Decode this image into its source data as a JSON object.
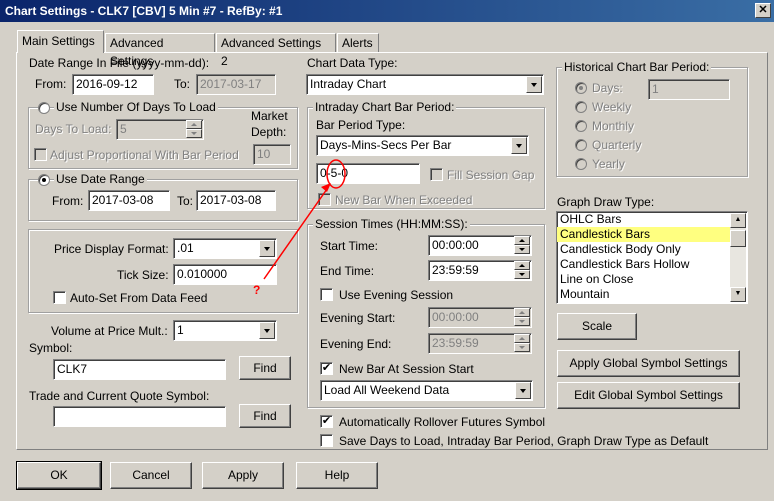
{
  "window": {
    "title": "Chart Settings - CLK7 [CBV]  5 Min   #7 - RefBy: #1",
    "close": "✕"
  },
  "tabs": [
    "Main Settings",
    "Advanced Settings",
    "Advanced Settings 2",
    "Alerts"
  ],
  "date_range_file": {
    "label": "Date Range In File (yyyy-mm-dd):",
    "from_label": "From:",
    "from": "2016-09-12",
    "to_label": "To:",
    "to": "2017-03-17"
  },
  "days_to_load": {
    "radio_label": "Use Number Of Days To Load",
    "days_label": "Days To Load:",
    "days": "5",
    "adjust_label": "Adjust Proportional With Bar Period",
    "depth_label_1": "Market",
    "depth_label_2": "Depth:",
    "depth": "10"
  },
  "date_range": {
    "radio_label": "Use Date Range",
    "from_label": "From:",
    "from": "2017-03-08",
    "to_label": "To:",
    "to": "2017-03-08"
  },
  "price": {
    "format_label": "Price Display Format:",
    "format": ".01",
    "tick_label": "Tick Size:",
    "tick": "0.010000",
    "autoset_label": "Auto-Set From Data Feed"
  },
  "volume": {
    "label": "Volume at Price Mult.:",
    "value": "1"
  },
  "symbol": {
    "label": "Symbol:",
    "value": "CLK7",
    "find": "Find"
  },
  "trade_symbol": {
    "label": "Trade and Current Quote Symbol:",
    "value": "",
    "find": "Find"
  },
  "chart_data_type": {
    "label": "Chart Data Type:",
    "value": "Intraday Chart"
  },
  "intraday_period": {
    "group": "Intraday Chart Bar Period:",
    "type_label": "Bar Period Type:",
    "type": "Days-Mins-Secs Per Bar",
    "value": "0-5-0",
    "fill_gap": "Fill Session Gap",
    "new_bar": "New Bar When Exceeded"
  },
  "session": {
    "group": "Session Times (HH:MM:SS):",
    "start_label": "Start Time:",
    "start": "00:00:00",
    "end_label": "End Time:",
    "end": "23:59:59",
    "evening_cb": "Use Evening Session",
    "ev_start_label": "Evening Start:",
    "ev_start": "00:00:00",
    "ev_end_label": "Evening End:",
    "ev_end": "23:59:59",
    "new_bar_label": "New Bar At Session Start",
    "weekend": "Load All Weekend Data"
  },
  "options": {
    "rollover": "Automatically Rollover Futures Symbol",
    "save_days": "Save Days to Load, Intraday Bar Period, Graph Draw Type as Default"
  },
  "historical": {
    "group": "Historical Chart Bar Period:",
    "days": "Days:",
    "days_value": "1",
    "weekly": "Weekly",
    "monthly": "Monthly",
    "quarterly": "Quarterly",
    "yearly": "Yearly"
  },
  "graph_draw": {
    "label": "Graph Draw Type:",
    "items": [
      "OHLC Bars",
      "Candlestick Bars",
      "Candlestick Body Only",
      "Candlestick Bars Hollow",
      "Line on Close",
      "Mountain"
    ],
    "selected": 1
  },
  "buttons": {
    "scale": "Scale",
    "apply_global": "Apply Global Symbol Settings",
    "edit_global": "Edit Global Symbol Settings",
    "ok": "OK",
    "cancel": "Cancel",
    "apply": "Apply",
    "help": "Help"
  },
  "annotation": {
    "mark": "?",
    "color": "#ff0000"
  }
}
